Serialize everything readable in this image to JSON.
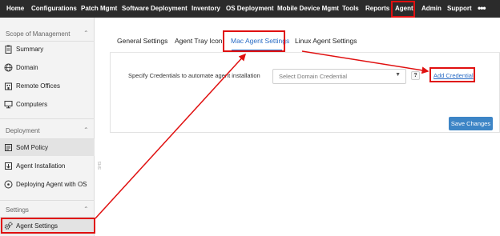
{
  "topnav": {
    "items": [
      "Home",
      "Configurations",
      "Patch Mgmt",
      "Software Deployment",
      "Inventory",
      "OS Deployment",
      "Mobile Device Mgmt",
      "Tools",
      "Reports",
      "Agent",
      "Admin",
      "Support"
    ],
    "more": "•••"
  },
  "sidebar": {
    "scope_header": "Scope of Management",
    "scope_items": [
      "Summary",
      "Domain",
      "Remote Offices",
      "Computers"
    ],
    "deployment_header": "Deployment",
    "deployment_items": [
      "SoM Policy",
      "Agent Installation",
      "Deploying Agent with OS"
    ],
    "settings_header": "Settings",
    "settings_items": [
      "Agent Settings"
    ],
    "chevron": "⌃"
  },
  "tabs": [
    "General Settings",
    "Agent Tray Icon",
    "Mac Agent Settings",
    "Linux Agent Settings"
  ],
  "form": {
    "label": "Specify Credentials to automate agent installation",
    "select_placeholder": "Select Domain Credential",
    "help": "?",
    "add_credential": "Add Credential",
    "save": "Save Changes"
  },
  "side_vertical_text": "SHS",
  "colors": {
    "highlight": "#e01010",
    "accent": "#2a6cc5",
    "nav_bg": "#2b2b2b"
  }
}
